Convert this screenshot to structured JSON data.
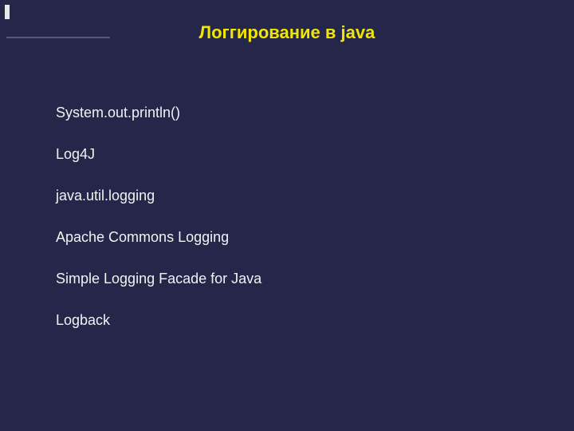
{
  "title": "Логгирование в java",
  "items": [
    "System.out.println()",
    "Log4J",
    "java.util.logging",
    "Apache Commons Logging",
    "Simple Logging Facade for Java",
    "Logback"
  ]
}
